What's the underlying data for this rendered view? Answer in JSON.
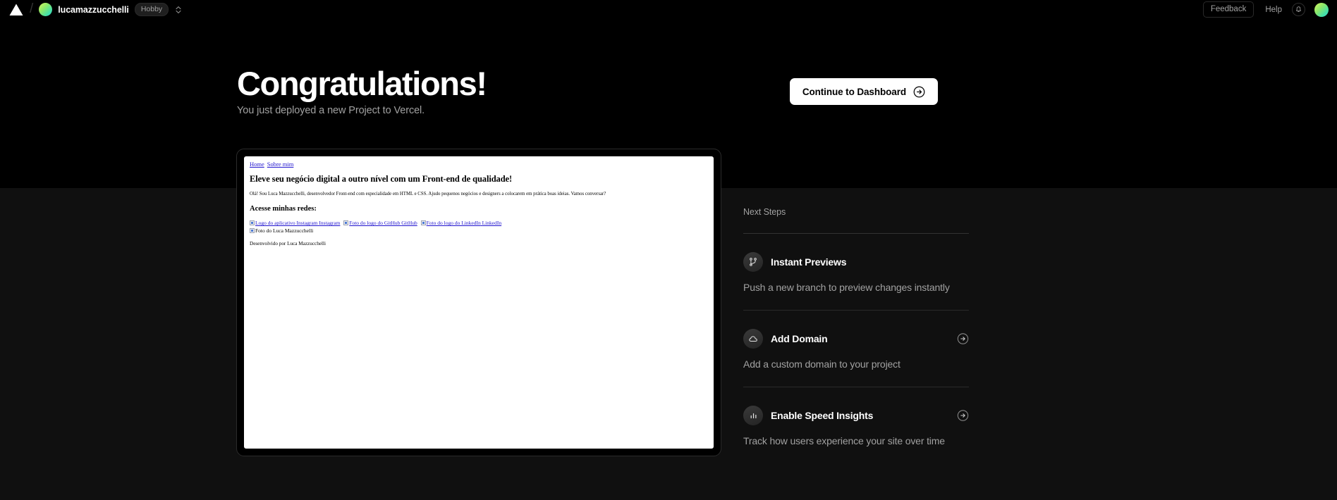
{
  "header": {
    "logo_icon": "vercel-triangle-icon",
    "breadcrumb_separator": "/",
    "team_name": "lucamazzucchelli",
    "plan_badge": "Hobby",
    "selector_icon": "chevron-up-down-icon",
    "feedback_label": "Feedback",
    "help_label": "Help",
    "notifications_icon": "bell-icon",
    "avatar_icon": "user-avatar"
  },
  "hero": {
    "title": "Congratulations!",
    "subtitle": "You just deployed a new Project to Vercel.",
    "cta_label": "Continue to Dashboard",
    "cta_icon": "arrow-right-circle-icon"
  },
  "preview": {
    "nav": [
      {
        "label": "Home"
      },
      {
        "label": "Sobre mim"
      }
    ],
    "heading": "Eleve seu negócio digital a outro nível com um Front-end de qualidade!",
    "paragraph": "Olá! Sou Luca Mazzucchelli, desenvolvedor Front-end com especialidade em HTML e CSS. Ajudo pequenos negócios e designers a colocarem em prática boas ideias. Vamos conversar?",
    "subheading": "Acesse minhas redes:",
    "social_links": [
      {
        "alt": "Logo do aplicativo Instagram",
        "label": "Instagram"
      },
      {
        "alt": "Foto do logo do GitHub",
        "label": "GitHub"
      },
      {
        "alt": "Foto do logo do LinkedIn",
        "label": "LinkedIn"
      }
    ],
    "broken_image_alt": "Foto do Luca Mazzucchelli",
    "footer": "Desenvolvido por Luca Mazzucchelli"
  },
  "next_steps": {
    "heading": "Next Steps",
    "items": [
      {
        "title": "Instant Previews",
        "description": "Push a new branch to preview changes instantly",
        "icon": "git-branch-icon",
        "has_arrow": false
      },
      {
        "title": "Add Domain",
        "description": "Add a custom domain to your project",
        "icon": "globe-cloud-icon",
        "has_arrow": true
      },
      {
        "title": "Enable Speed Insights",
        "description": "Track how users experience your site over time",
        "icon": "bar-chart-icon",
        "has_arrow": true
      }
    ]
  },
  "colors": {
    "background": "#000000",
    "panel": "#101010",
    "accent_white": "#ffffff",
    "muted_text": "#a1a1a1",
    "link_blue": "#2014cf"
  }
}
